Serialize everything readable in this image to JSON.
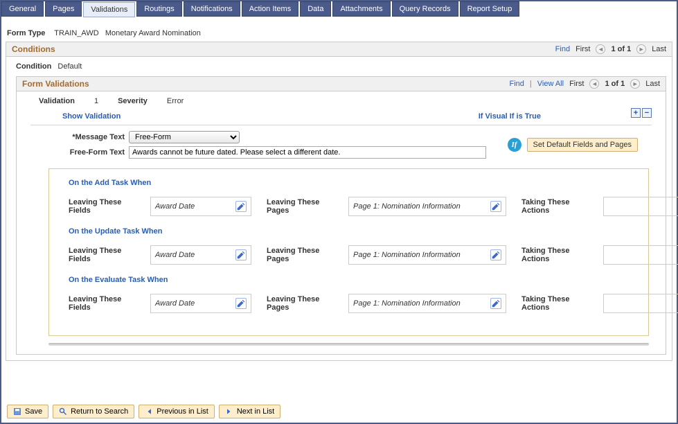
{
  "tabs": [
    "General",
    "Pages",
    "Validations",
    "Routings",
    "Notifications",
    "Action Items",
    "Data",
    "Attachments",
    "Query Records",
    "Report Setup"
  ],
  "active_tab": "Validations",
  "form_type": {
    "label": "Form Type",
    "code": "TRAIN_AWD",
    "desc": "Monetary Award Nomination"
  },
  "conditions": {
    "title": "Conditions",
    "find": "Find",
    "first": "First",
    "last": "Last",
    "counter": "1 of 1",
    "condition_label": "Condition",
    "condition_value": "Default"
  },
  "form_validations": {
    "title": "Form Validations",
    "find": "Find",
    "view_all": "View All",
    "first": "First",
    "last": "Last",
    "counter": "1 of 1",
    "validation_label": "Validation",
    "validation_value": "1",
    "severity_label": "Severity",
    "severity_value": "Error",
    "show_validation": "Show Validation",
    "if_visual": "If Visual If is True",
    "msg_text_label": "*Message Text",
    "msg_text_value": "Free-Form",
    "freeform_label": "Free-Form Text",
    "freeform_value": "Awards cannot be future dated. Please select a different date.",
    "set_default_btn": "Set Default Fields and Pages",
    "tasks": {
      "add": "On the Add Task When",
      "update": "On the Update Task When",
      "evaluate": "On the Evaluate Task When"
    },
    "leaving_fields_label": "Leaving These Fields",
    "leaving_pages_label": "Leaving These Pages",
    "taking_actions_label": "Taking These Actions",
    "field_value": "Award Date",
    "page_value": "Page 1: Nomination Information",
    "action_value": ""
  },
  "footer": {
    "save": "Save",
    "return": "Return to Search",
    "prev": "Previous in List",
    "next": "Next in List"
  }
}
